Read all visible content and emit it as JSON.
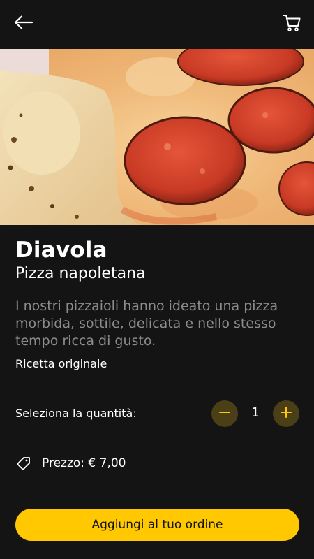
{
  "header": {
    "back_icon": "arrow-left-icon",
    "cart_icon": "shopping-cart-icon"
  },
  "hero": {
    "image": "pizza-diavola-photo"
  },
  "product": {
    "name": "Diavola",
    "category": "Pizza napoletana",
    "description": "I nostri pizzaioli hanno ideato una pizza morbida, sottile, delicata e nello stesso tempo ricca di gusto.",
    "recipe": "Ricetta originale"
  },
  "quantity": {
    "label": "Seleziona la quantità:",
    "value": "1",
    "minus_icon": "minus-icon",
    "plus_icon": "plus-icon"
  },
  "price": {
    "icon": "price-tag-icon",
    "label": "Prezzo: € 7,00"
  },
  "cta": {
    "label": "Aggiungi al tuo ordine"
  },
  "colors": {
    "background": "#141414",
    "accent": "#ffc800",
    "stepper_bg": "#4a3f16",
    "muted_text": "#8c8c8c"
  }
}
